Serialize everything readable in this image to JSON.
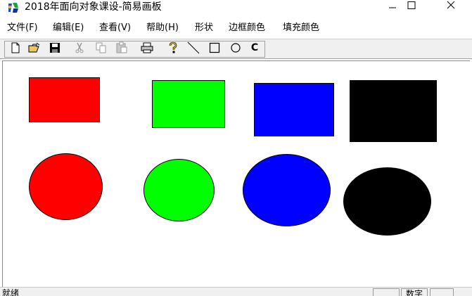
{
  "window": {
    "title": "2018年面向对象课设-简易画板",
    "minimize_icon": "minimize-icon",
    "maximize_icon": "maximize-icon",
    "close_icon": "close-icon"
  },
  "menu": {
    "items": [
      {
        "label": "文件(F)"
      },
      {
        "label": "编辑(E)"
      },
      {
        "label": "查看(V)"
      },
      {
        "label": "帮助(H)"
      },
      {
        "label": "形状"
      },
      {
        "label": "边框颜色"
      },
      {
        "label": "填充颜色"
      }
    ]
  },
  "toolbar": {
    "icons": [
      "new-file-icon",
      "open-folder-icon",
      "save-disk-icon",
      "cut-icon",
      "copy-icon",
      "paste-icon",
      "print-icon",
      "help-icon",
      "line-tool-icon",
      "rectangle-tool-icon",
      "ellipse-tool-icon",
      "clear-tool-icon"
    ],
    "clear_label": "C"
  },
  "canvas": {
    "colors": {
      "red": "#ff0000",
      "green": "#00ff00",
      "blue": "#0000ff",
      "black": "#000000"
    }
  },
  "status": {
    "text": "就绪",
    "num_lock": "数字"
  }
}
